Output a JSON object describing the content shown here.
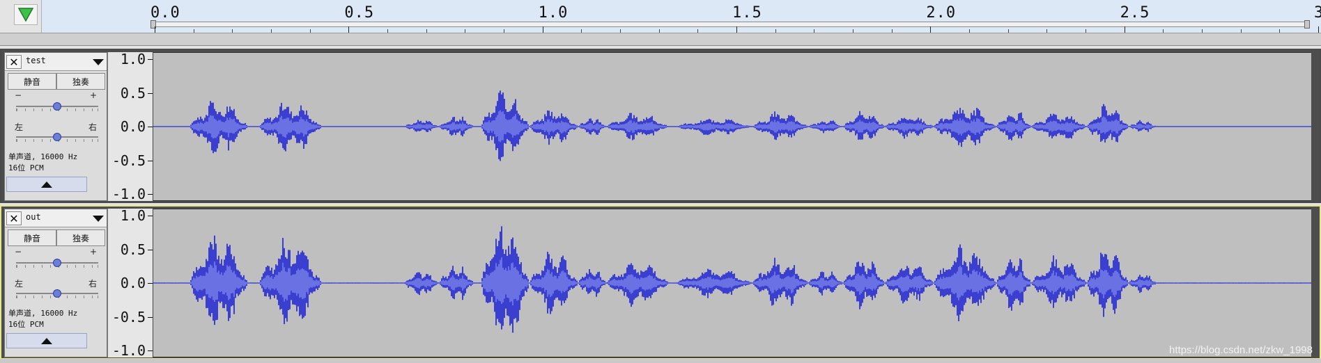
{
  "ruler": {
    "play_icon": "green-triangle-down",
    "labels": [
      "0.0",
      "0.5",
      "1.0",
      "1.5",
      "2.0",
      "2.5",
      "3."
    ]
  },
  "tracks": [
    {
      "name": "test",
      "close_icon": "✕",
      "mute_label": "静音",
      "solo_label": "独奏",
      "gain_minus": "−",
      "gain_plus": "+",
      "pan_left": "左",
      "pan_right": "右",
      "gain_level": 0.5,
      "pan_level": 0.5,
      "info_line1": "单声道, 16000 Hz",
      "info_line2": "16位 PCM",
      "scale": [
        "1.0",
        "0.5",
        "0.0",
        "-0.5",
        "-1.0"
      ],
      "selected": false
    },
    {
      "name": "out",
      "close_icon": "✕",
      "mute_label": "静音",
      "solo_label": "独奏",
      "gain_minus": "−",
      "gain_plus": "+",
      "pan_left": "左",
      "pan_right": "右",
      "gain_level": 0.5,
      "pan_level": 0.5,
      "info_line1": "单声道, 16000 Hz",
      "info_line2": "16位 PCM",
      "scale": [
        "1.0",
        "0.5",
        "0.0",
        "-0.5",
        "-1.0"
      ],
      "selected": true
    }
  ],
  "colors": {
    "waveform": "#3a3fcf",
    "waveform_rms": "#6a72e3",
    "wave_bg": "#bfbfbf",
    "selected_border": "#e6e68a"
  },
  "watermark": "https://blog.csdn.net/zkw_1998"
}
